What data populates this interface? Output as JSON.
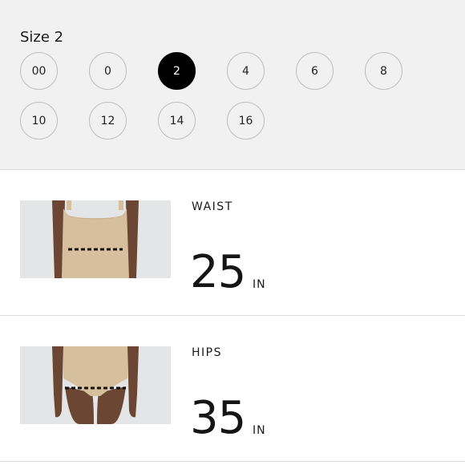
{
  "size_selector": {
    "title": "Size 2",
    "selected": "2",
    "options": [
      "00",
      "0",
      "2",
      "4",
      "6",
      "8",
      "10",
      "12",
      "14",
      "16"
    ]
  },
  "measurements": [
    {
      "label": "WAIST",
      "value": "25",
      "unit": "IN",
      "image": "model-waist-photo"
    },
    {
      "label": "HIPS",
      "value": "35",
      "unit": "IN",
      "image": "model-hips-photo"
    }
  ],
  "colors": {
    "panel_bg": "#f1f1f1",
    "selected_bg": "#000000",
    "garment": "#d6bf9c",
    "skin": "#6b4632",
    "measure_line": "#111111"
  }
}
